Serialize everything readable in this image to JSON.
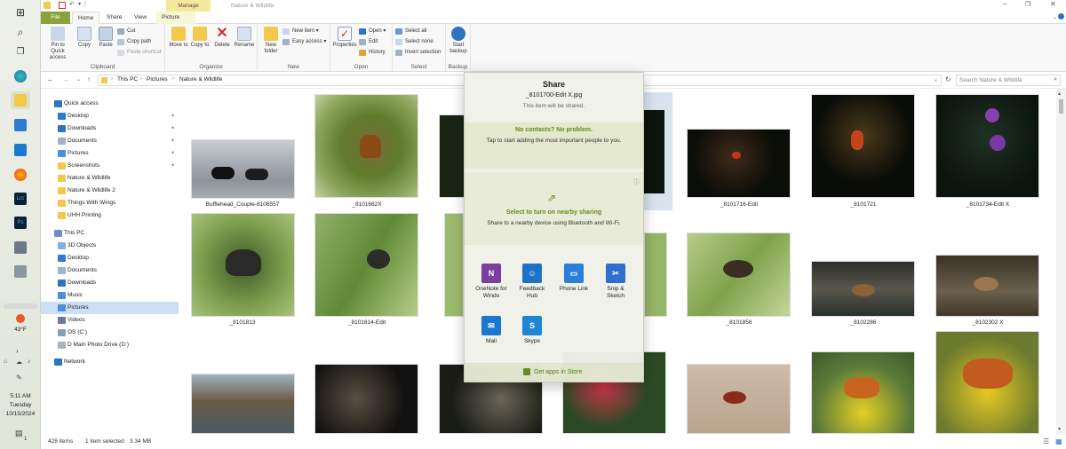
{
  "window": {
    "title": "Nature & Wildlife",
    "manage_tab": "Manage",
    "qat_icons": [
      "folder-icon",
      "check-icon",
      "undo-icon",
      "dropdown-icon"
    ]
  },
  "ribbon_tabs": [
    "File",
    "Home",
    "Share",
    "View",
    "Picture Tools"
  ],
  "ribbon": {
    "clipboard": {
      "pin": "Pin to Quick access",
      "copy": "Copy",
      "paste": "Paste",
      "cut": "Cut",
      "copy_path": "Copy path",
      "paste_shortcut": "Paste shortcut",
      "label": "Clipboard"
    },
    "organize": {
      "move_to": "Move to",
      "copy_to": "Copy to",
      "delete": "Delete",
      "rename": "Rename",
      "label": "Organize"
    },
    "new": {
      "new_folder": "New folder",
      "new_item": "New item",
      "easy_access": "Easy access",
      "label": "New"
    },
    "open": {
      "properties": "Properties",
      "open": "Open",
      "edit": "Edit",
      "history": "History",
      "label": "Open"
    },
    "select": {
      "select_all": "Select all",
      "select_none": "Select none",
      "invert": "Invert selection",
      "label": "Select"
    },
    "backup": {
      "start_backup": "Start backup",
      "label": "Backup"
    }
  },
  "address": {
    "crumbs": [
      "This PC",
      "Pictures",
      "Nature & Wildlife"
    ],
    "search_placeholder": "Search Nature & Wildlife"
  },
  "nav": {
    "quick_access": "Quick access",
    "quick": [
      "Desktop",
      "Downloads",
      "Documents",
      "Pictures",
      "Screenshots",
      "Nature & Wildlife",
      "Nature & Wildlife 2",
      "Things With Wings",
      "UHH Printing"
    ],
    "this_pc": "This PC",
    "pc": [
      "3D Objects",
      "Desktop",
      "Documents",
      "Downloads",
      "Music",
      "Pictures",
      "Videos",
      "OS (C:)",
      "D Main Photo Drive (D:)"
    ],
    "network": "Network"
  },
  "files": {
    "row1": [
      "Bufflehead_Couple-8106557",
      "_8101662X",
      "_8101716-Edit",
      "_8101721",
      "_8101734-Edit X"
    ],
    "row2": [
      "_8101813",
      "_8101814-Edit",
      "_8101856",
      "_8102286",
      "_8102302 X"
    ]
  },
  "status": {
    "count": "428 items",
    "selected": "1 item selected",
    "size": "3.34 MB"
  },
  "taskbar": {
    "temp": "43°F",
    "time": "5:11 AM",
    "day": "Tuesday",
    "date": "10/15/2024",
    "notif_count": "1"
  },
  "share": {
    "title": "Share",
    "filename": "_8101700-Edit X.jpg",
    "subtitle": "This item will be shared.",
    "no_contacts": "No contacts? No problem.",
    "contacts_hint": "Tap to start adding the most important people to you.",
    "nearby_title": "Select to turn on nearby sharing",
    "nearby_hint": "Share to a nearby device using Bluetooth and Wi-Fi.",
    "apps": [
      {
        "name": "OneNote for Windo",
        "color": "#7b3fa0",
        "glyph": "N"
      },
      {
        "name": "Feedback Hub",
        "color": "#1e73c8",
        "glyph": "☺"
      },
      {
        "name": "Phone Link",
        "color": "#2a7fd8",
        "glyph": "▭"
      },
      {
        "name": "Snip & Sketch",
        "color": "#2e6fd0",
        "glyph": "✂"
      },
      {
        "name": "Mail",
        "color": "#1a78d0",
        "glyph": "✉"
      },
      {
        "name": "Skype",
        "color": "#1d86d4",
        "glyph": "S"
      }
    ],
    "store": "Get apps in Store"
  }
}
